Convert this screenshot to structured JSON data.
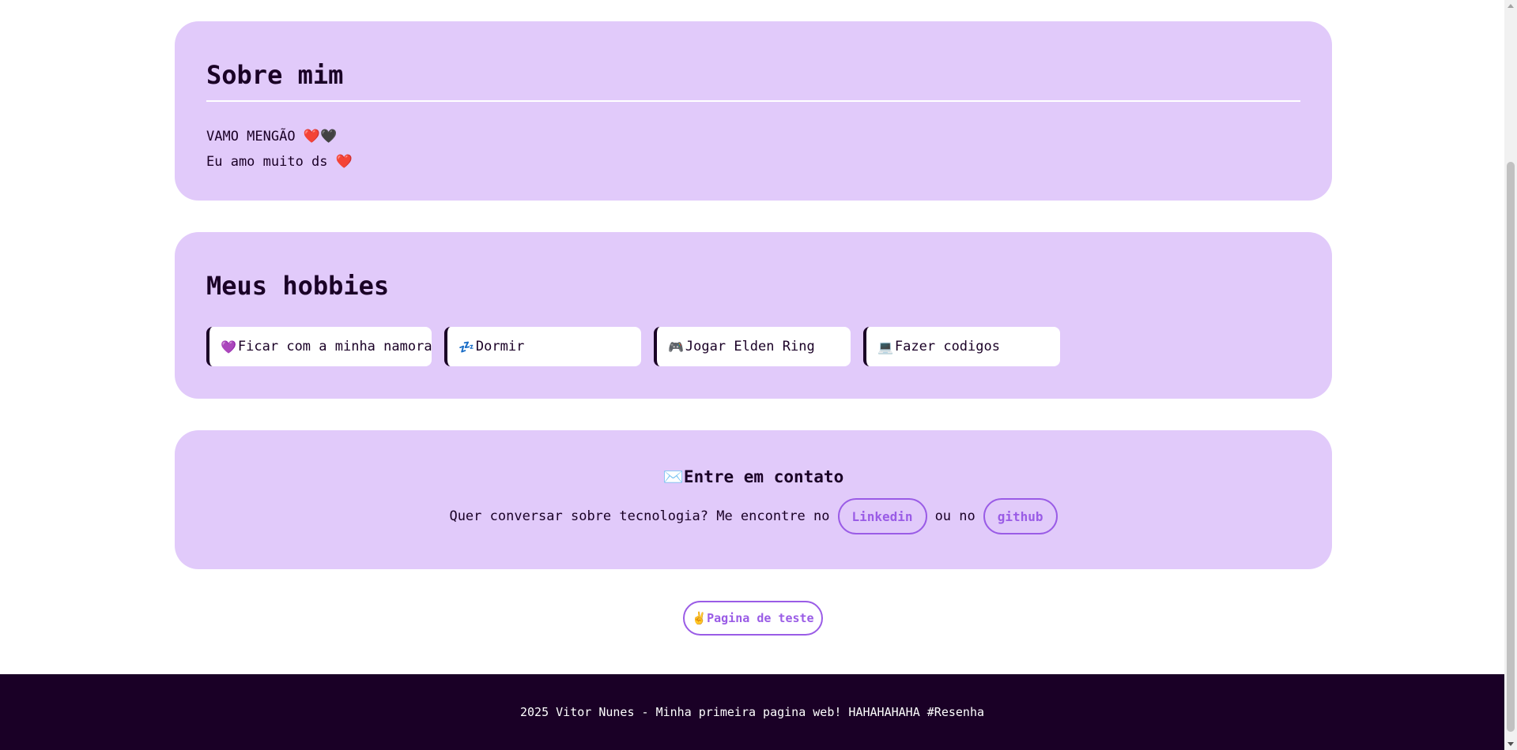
{
  "about": {
    "title": "Sobre mim",
    "line1": "VAMO MENGÃO ❤️🖤",
    "line2": "Eu amo muito ds ❤️"
  },
  "hobbies": {
    "title": "Meus hobbies",
    "items": [
      {
        "emoji": "💜",
        "label": "Ficar com a minha namorada"
      },
      {
        "emoji": "💤",
        "label": "Dormir"
      },
      {
        "emoji": "🎮",
        "label": "Jogar Elden Ring"
      },
      {
        "emoji": "💻",
        "label": "Fazer codigos"
      }
    ]
  },
  "contact": {
    "emoji": "✉️",
    "title": "Entre em contato",
    "text_before": "Quer conversar sobre tecnologia? Me encontre no",
    "linkedin_label": "Linkedin",
    "text_between": "ou no",
    "github_label": "github"
  },
  "test_button": {
    "emoji": "✌️",
    "label": "Pagina de teste"
  },
  "footer": {
    "text": "2025 Vitor Nunes - Minha primeira pagina web! HAHAHAHAHA #Resenha"
  },
  "colors": {
    "card_bg": "#e1cafa",
    "accent": "#9a5ce6",
    "dark": "#1a0026"
  },
  "icons": {
    "scroll_up": "arrow-up-icon",
    "scroll_down": "arrow-down-icon"
  }
}
